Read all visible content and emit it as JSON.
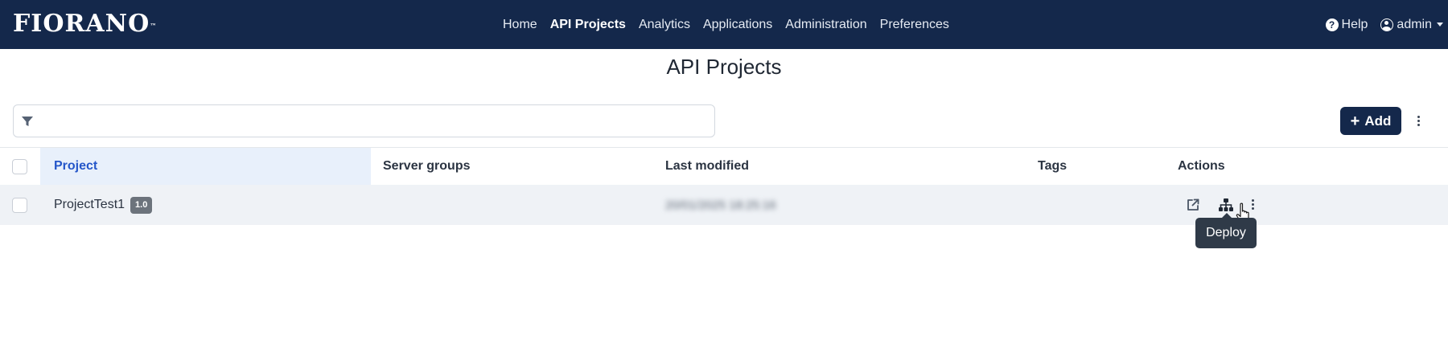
{
  "app": {
    "logo_text": "Fiorano",
    "logo_mark": "™"
  },
  "nav": {
    "links": [
      "Home",
      "API Projects",
      "Analytics",
      "Applications",
      "Administration",
      "Preferences"
    ],
    "active_index": 1,
    "help_label": "Help",
    "user_label": "admin"
  },
  "page": {
    "title": "API Projects"
  },
  "toolbar": {
    "filter_value": "",
    "filter_placeholder": "",
    "add_label": "Add"
  },
  "table": {
    "columns": {
      "project": "Project",
      "server_groups": "Server groups",
      "last_modified": "Last modified",
      "tags": "Tags",
      "actions": "Actions"
    },
    "rows": [
      {
        "project": "ProjectTest1",
        "version": "1.0",
        "server_groups": "",
        "last_modified": "20/01/2025 18:25:16",
        "tags": ""
      }
    ]
  },
  "tooltip": {
    "text": "Deploy"
  },
  "colors": {
    "navbar_bg": "#14284b",
    "accent_blue": "#2456c9",
    "sorted_col_bg": "#e8f0fb",
    "row_bg": "#eff2f6",
    "badge_bg": "#6c737c",
    "tooltip_bg": "#2f3a48"
  },
  "icons": {
    "filter": "funnel-icon",
    "add": "plus-icon",
    "open": "external-link-icon",
    "deploy": "sitemap-icon",
    "more": "kebab-icon",
    "help": "question-circle-icon",
    "user": "user-circle-icon"
  }
}
